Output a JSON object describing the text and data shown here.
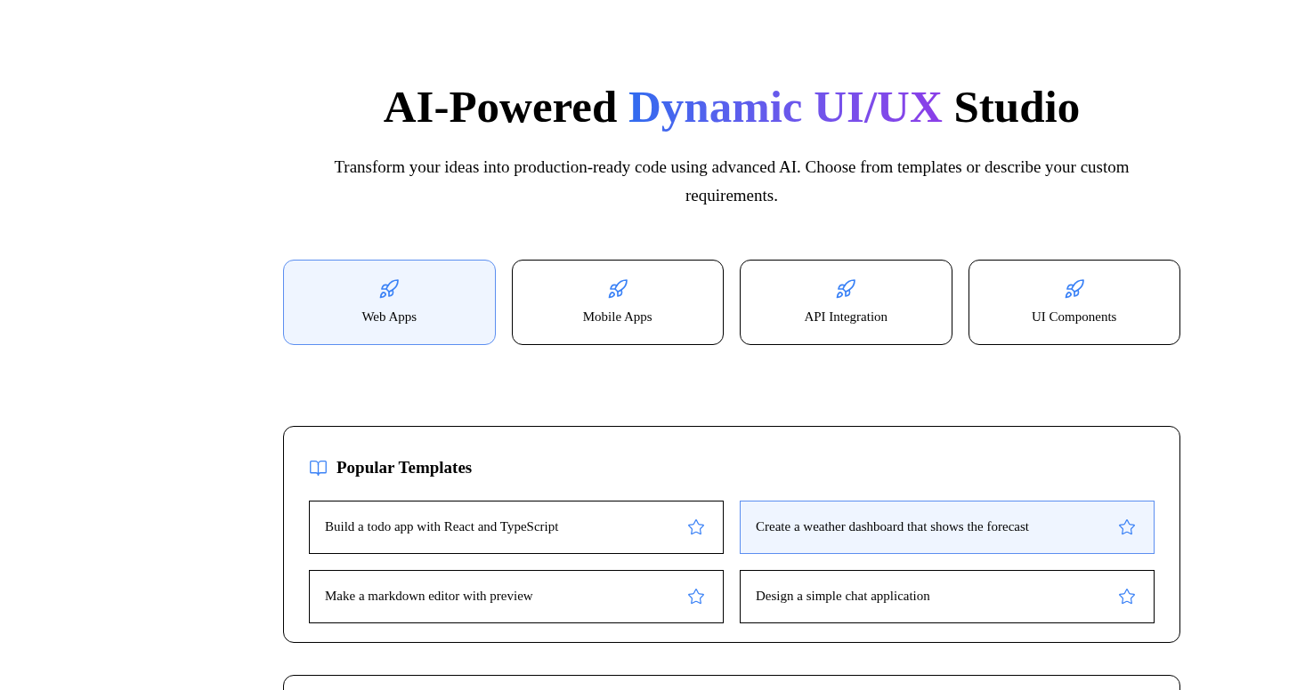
{
  "hero": {
    "title_start": "AI-Powered",
    "title_highlight": "Dynamic UI/UX",
    "title_end": "Studio",
    "subtitle": "Transform your ideas into production-ready code using advanced AI. Choose from templates or describe your custom requirements."
  },
  "categories": [
    {
      "label": "Web Apps",
      "selected": true
    },
    {
      "label": "Mobile Apps",
      "selected": false
    },
    {
      "label": "API Integration",
      "selected": false
    },
    {
      "label": "UI Components",
      "selected": false
    }
  ],
  "templates": {
    "title": "Popular Templates",
    "items": [
      {
        "label": "Build a todo app with React and TypeScript",
        "selected": false
      },
      {
        "label": "Create a weather dashboard that shows the forecast",
        "selected": true
      },
      {
        "label": "Make a markdown editor with preview",
        "selected": false
      },
      {
        "label": "Design a simple chat application",
        "selected": false
      }
    ]
  }
}
